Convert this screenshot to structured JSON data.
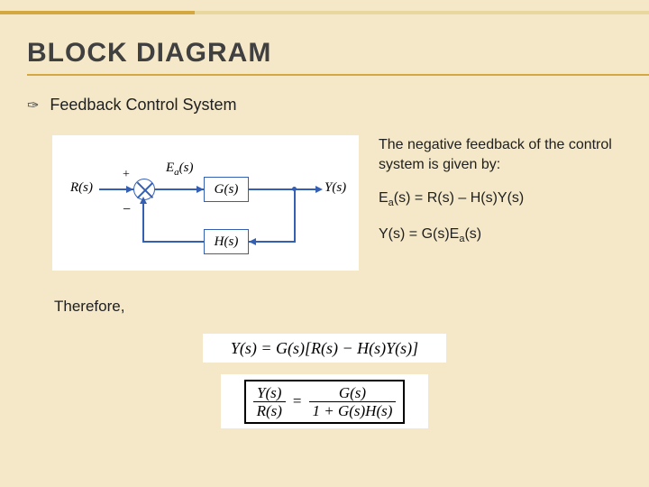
{
  "heading": "BLOCK DIAGRAM",
  "subtitle": "Feedback Control System",
  "description": "The negative feedback of the control system is given by:",
  "equations": {
    "ea": "E",
    "ea_sub": "a",
    "ea_rest": "(s) = R(s) – H(s)Y(s)",
    "y": "Y(s) = G(s)E",
    "y_sub": "a",
    "y_rest": "(s)"
  },
  "therefore": "Therefore,",
  "derived_eq": "Y(s) = G(s)[R(s) − H(s)Y(s)]",
  "tf": {
    "lhs_num": "Y(s)",
    "lhs_den": "R(s)",
    "eq": "=",
    "rhs_num": "G(s)",
    "rhs_den": "1 + G(s)H(s)"
  },
  "diagram": {
    "R": "R(s)",
    "Ea": "E",
    "Ea_sub": "a",
    "Ea_rest": "(s)",
    "G": "G(s)",
    "H": "H(s)",
    "Y": "Y(s)",
    "plus": "+",
    "minus": "−"
  }
}
